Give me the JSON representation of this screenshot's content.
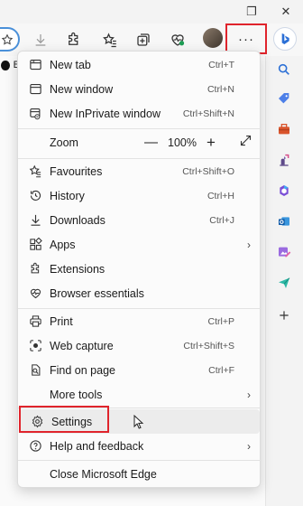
{
  "titlebar": {
    "restore_glyph": "❐",
    "close_glyph": "✕"
  },
  "toolbar": {
    "more_label": "···"
  },
  "favbar": {
    "letter": "B"
  },
  "colors": {
    "highlight_box": "#e0242c",
    "accent_blue": "#2b6fd6",
    "menu_bg": "#fbfbfb"
  },
  "menu": {
    "new_tab": {
      "label": "New tab",
      "shortcut": "Ctrl+T"
    },
    "new_window": {
      "label": "New window",
      "shortcut": "Ctrl+N"
    },
    "new_inprivate": {
      "label": "New InPrivate window",
      "shortcut": "Ctrl+Shift+N"
    },
    "zoom": {
      "label": "Zoom",
      "minus": "—",
      "value": "100%",
      "plus": "+"
    },
    "favourites": {
      "label": "Favourites",
      "shortcut": "Ctrl+Shift+O"
    },
    "history": {
      "label": "History",
      "shortcut": "Ctrl+H"
    },
    "downloads": {
      "label": "Downloads",
      "shortcut": "Ctrl+J"
    },
    "apps": {
      "label": "Apps",
      "arrow": "›"
    },
    "extensions": {
      "label": "Extensions"
    },
    "browser_essentials": {
      "label": "Browser essentials"
    },
    "print": {
      "label": "Print",
      "shortcut": "Ctrl+P"
    },
    "web_capture": {
      "label": "Web capture",
      "shortcut": "Ctrl+Shift+S"
    },
    "find_on_page": {
      "label": "Find on page",
      "shortcut": "Ctrl+F"
    },
    "more_tools": {
      "label": "More tools",
      "arrow": "›"
    },
    "settings": {
      "label": "Settings"
    },
    "help": {
      "label": "Help and feedback",
      "arrow": "›"
    },
    "close_edge": {
      "label": "Close Microsoft Edge"
    }
  },
  "icons": [
    "restore-icon",
    "close-icon",
    "favourite-star-icon",
    "download-icon",
    "extensions-icon",
    "favourites-icon",
    "collections-icon",
    "browser-essentials-icon",
    "profile-avatar",
    "more-icon",
    "bing-copilot-icon",
    "search-icon",
    "shopping-tag-icon",
    "tools-icon",
    "games-icon",
    "microsoft-365-icon",
    "outlook-icon",
    "designer-icon",
    "send-icon",
    "add-icon"
  ]
}
